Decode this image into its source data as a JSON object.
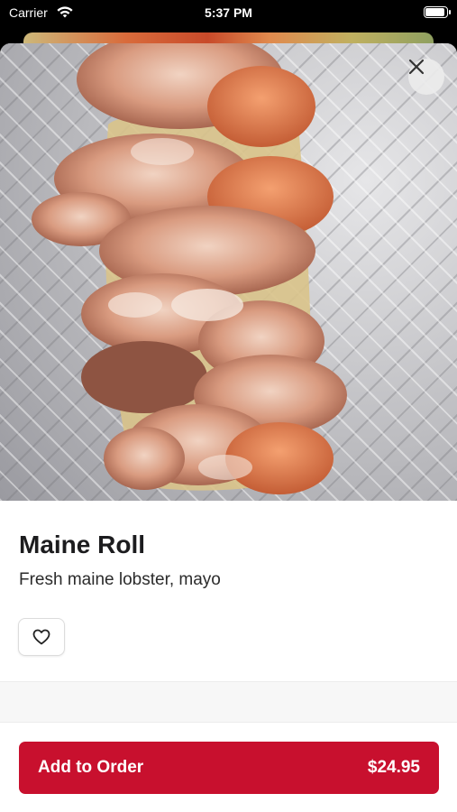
{
  "status_bar": {
    "carrier": "Carrier",
    "time": "5:37 PM"
  },
  "item": {
    "title": "Maine Roll",
    "description": "Fresh maine lobster, mayo"
  },
  "actions": {
    "add_label": "Add to Order",
    "price": "$24.95"
  },
  "colors": {
    "accent": "#c8102e"
  },
  "icons": {
    "close": "close-icon",
    "favorite": "heart-icon",
    "wifi": "wifi-icon",
    "battery": "battery-icon"
  }
}
